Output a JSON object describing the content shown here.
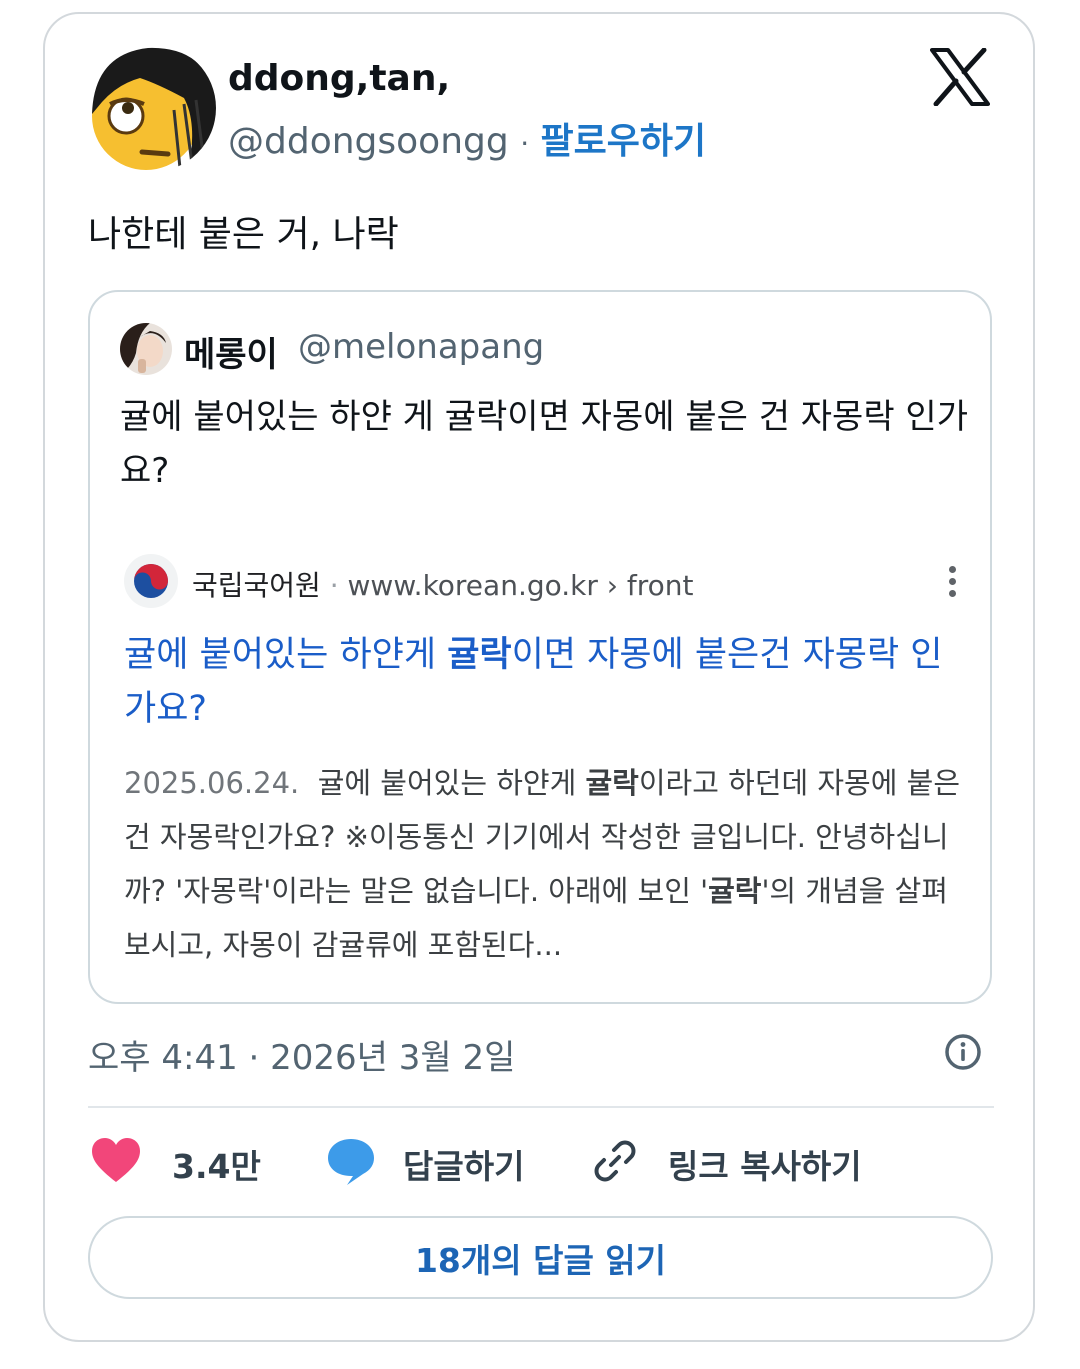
{
  "tweet": {
    "author": {
      "display_name": "ddong,tan,",
      "handle": "@ddongsoongg",
      "separator": "·",
      "follow_label": "팔로우하기"
    },
    "platform_icon": "x-logo-icon",
    "text": "나한테 붙은 거, 나락",
    "timestamp": "오후 4:41 · 2026년 3월 2일"
  },
  "quoted": {
    "display_name": "메롱이",
    "handle": "@melonapang",
    "text": "귤에 붙어있는 하얀 게 귤락이면 자몽에 붙은 건 자몽락 인가요?",
    "search_result": {
      "site_name": "국립국어원",
      "separator": "·",
      "url": "www.korean.go.kr › front",
      "title_before": "귤에 붙어있는 하얀게 ",
      "title_bold": "귤락",
      "title_after": "이면 자몽에 붙은건 자몽락 인가요?",
      "date": "2025.06.24.",
      "snippet_1": "  귤에 붙어있는 하얀게 ",
      "snippet_bold_1": "귤락",
      "snippet_2": "이라고 하던데 자몽에 붙은건 자몽락인가요? ※이동통신 기기에서 작성한 글입니다. 안녕하십니까? '자몽락'이라는 말은 없습니다. 아래에 보인 '",
      "snippet_bold_2": "귤락",
      "snippet_3": "'의 개념을 살펴보시고, 자몽이 감귤류에 포함된다..."
    }
  },
  "actions": {
    "like_count": "3.4만",
    "reply_label": "답글하기",
    "copy_link_label": "링크 복사하기"
  },
  "read_replies_label": "18개의 답글 읽기",
  "colors": {
    "link_blue": "#1d76c7",
    "heart_pink": "#f2467a",
    "reply_blue": "#3d9be9",
    "search_title_blue": "#1a5dc8"
  }
}
